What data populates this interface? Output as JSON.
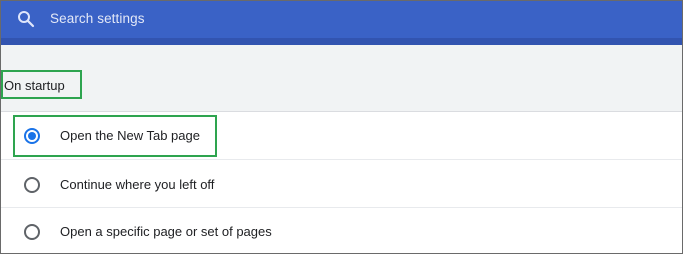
{
  "search": {
    "placeholder": "Search settings",
    "icon": "search-icon"
  },
  "section": {
    "title": "On startup"
  },
  "startup_options": [
    {
      "label": "Open the New Tab page",
      "selected": true
    },
    {
      "label": "Continue where you left off",
      "selected": false
    },
    {
      "label": "Open a specific page or set of pages",
      "selected": false
    }
  ],
  "colors": {
    "header": "#3a62c6",
    "radio_selected": "#1a73e8",
    "highlight": "#2ea44f"
  }
}
